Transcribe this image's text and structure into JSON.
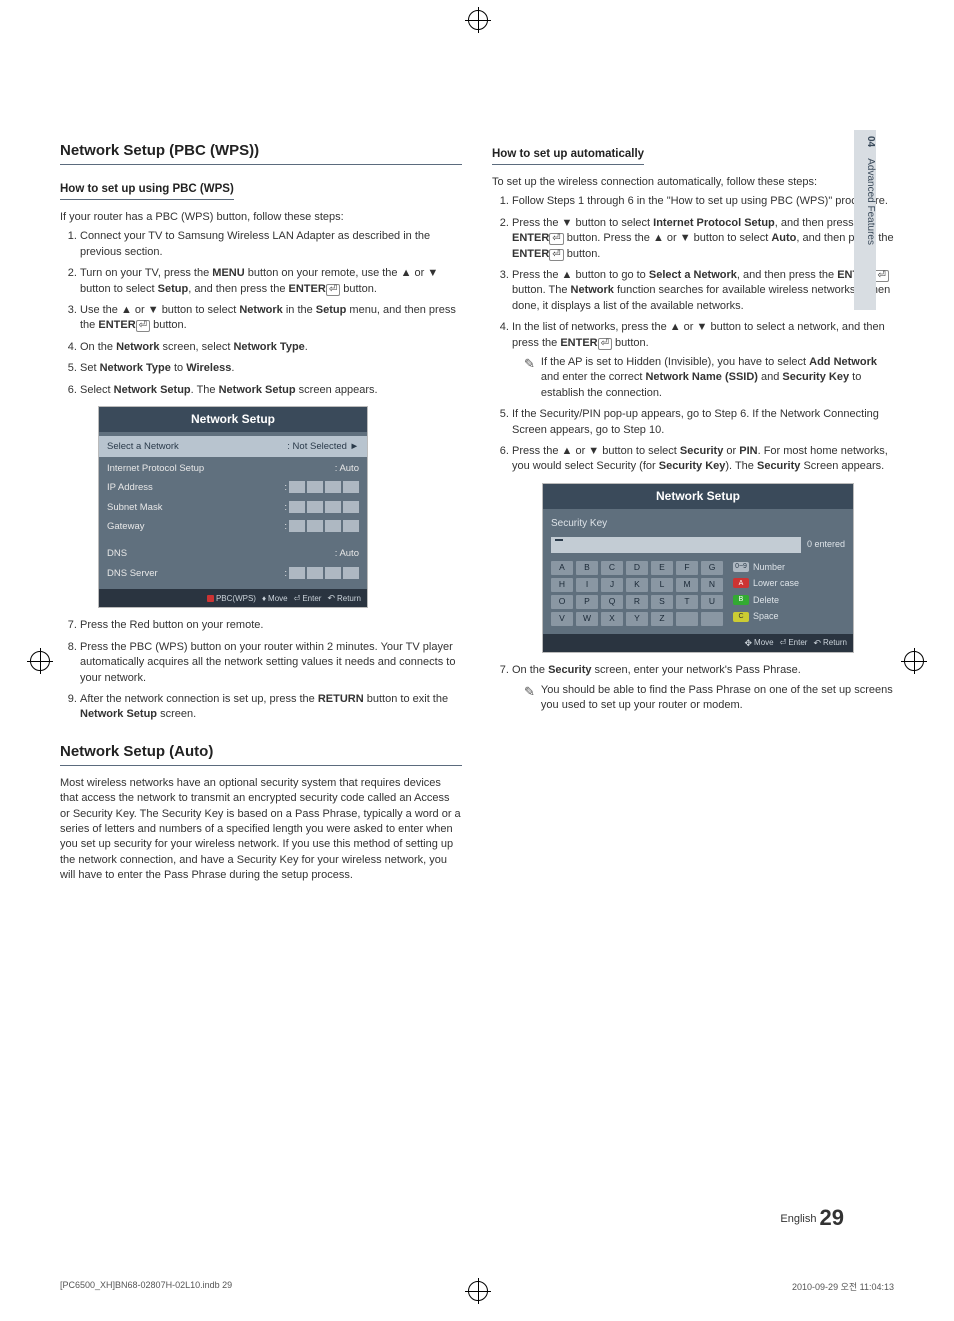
{
  "sideTab": {
    "num": "04",
    "label": "Advanced Features"
  },
  "left": {
    "title1": "Network Setup (PBC (WPS))",
    "sub1": "How to set up using PBC (WPS)",
    "intro1": "If your router has a PBC (WPS) button, follow these steps:",
    "s1": "Connect your TV to Samsung Wireless LAN Adapter as described in the previous section.",
    "s2a": "Turn on your TV, press the ",
    "s2_menu": "MENU",
    "s2b": " button on your remote, use the ▲ or ▼ button to select ",
    "s2_setup": "Setup",
    "s2c": ", and then press the ",
    "s2_enter": "ENTER",
    "s2d": " button.",
    "s3a": "Use the ▲ or ▼ button to select ",
    "s3_network": "Network",
    "s3b": " in the ",
    "s3_setup": "Setup",
    "s3c": " menu, and then press the ",
    "s3d": " button.",
    "s4a": "On the ",
    "s4_network": "Network",
    "s4b": " screen, select ",
    "s4_type": "Network Type",
    "s4c": ".",
    "s5a": "Set ",
    "s5_type": "Network Type",
    "s5b": " to ",
    "s5_wireless": "Wireless",
    "s5c": ".",
    "s6a": "Select ",
    "s6_ns": "Network Setup",
    "s6b": ". The ",
    "s6_ns2": "Network Setup",
    "s6c": " screen appears.",
    "tv": {
      "title": "Network Setup",
      "row1l": "Select a Network",
      "row1r": ": Not Selected   ►",
      "row2l": "Internet Protocol Setup",
      "row2r": ": Auto",
      "row3l": "IP Address",
      "row4l": "Subnet Mask",
      "row5l": "Gateway",
      "row6l": "DNS",
      "row6r": ": Auto",
      "row7l": "DNS Server",
      "f1": "PBC(WPS)",
      "f2": "Move",
      "f3": "Enter",
      "f4": "Return"
    },
    "s7": "Press the Red button on your remote.",
    "s8": "Press the PBC (WPS) button on your router within 2 minutes. Your TV player automatically acquires all the network setting values it needs and connects to your network.",
    "s9a": "After the network connection is set up, press the ",
    "s9_return": "RETURN",
    "s9b": " button to exit the ",
    "s9_ns": "Network Setup",
    "s9c": " screen.",
    "title2": "Network Setup (Auto)",
    "autoPara": "Most wireless networks have an optional security system that requires devices that access the network to transmit an encrypted security code called an Access or Security Key. The Security Key is based on a Pass Phrase, typically a word or a series of letters and numbers of a specified length you were asked to enter when you set up security for your wireless network.  If you use this method of setting up the network connection, and have a Security Key for your wireless network, you will have to enter the Pass Phrase during the setup process."
  },
  "right": {
    "sub1": "How to set up automatically",
    "intro1": "To set up the wireless connection automatically, follow these steps:",
    "s1": "Follow Steps 1 through 6 in the \"How to set up using PBC (WPS)\" procedure.",
    "s2a": "Press the ▼ button to select ",
    "s2_ips": "Internet Protocol Setup",
    "s2b": ", and then press the ",
    "s2_enter": "ENTER",
    "s2c": " button. Press the ▲ or ▼ button to select ",
    "s2_auto": "Auto",
    "s2d": ", and then press the ",
    "s2e": " button.",
    "s3a": "Press the ▲ button to go to ",
    "s3_sel": "Select a Network",
    "s3b": ", and then press the ",
    "s3c": " button. The ",
    "s3_net": "Network",
    "s3d": " function searches for available wireless networks. When done, it displays a list of the available networks.",
    "s4a": "In the list of networks, press the ▲ or ▼ button to select a network, and then press the ",
    "s4b": " button.",
    "note1a": "If the AP is set to Hidden (Invisible), you have to select ",
    "note1_add": "Add Network",
    "note1b": " and enter the correct ",
    "note1_ssid": "Network Name (SSID)",
    "note1c": " and ",
    "note1_key": "Security Key",
    "note1d": " to establish the connection.",
    "s5": "If the Security/PIN pop-up appears, go to Step 6. If the Network Connecting Screen appears, go to Step 10.",
    "s6a": "Press the ▲ or ▼ button to select ",
    "s6_sec": "Security",
    "s6b": " or ",
    "s6_pin": "PIN",
    "s6c": ". For most home networks, you would select Security (for ",
    "s6_skey": "Security Key",
    "s6d": "). The ",
    "s6_sec2": "Security",
    "s6e": " Screen appears.",
    "kb": {
      "title": "Network Setup",
      "label": "Security Key",
      "entered": "0 entered",
      "sideNum": "Number",
      "sideLower": "Lower case",
      "sideDelete": "Delete",
      "sideSpace": "Space",
      "numChip": "0~9",
      "f2": "Move",
      "f3": "Enter",
      "f4": "Return",
      "keys": [
        "A",
        "B",
        "C",
        "D",
        "E",
        "F",
        "G",
        "H",
        "I",
        "J",
        "K",
        "L",
        "M",
        "N",
        "O",
        "P",
        "Q",
        "R",
        "S",
        "T",
        "U",
        "V",
        "W",
        "X",
        "Y",
        "Z",
        "",
        ""
      ]
    },
    "s7a": "On the ",
    "s7_sec": "Security",
    "s7b": " screen, enter your network's Pass Phrase.",
    "note2": "You should be able to find the Pass Phrase on one of the set up screens you used to set up your router or modem."
  },
  "footer": {
    "lang": "English",
    "page": "29"
  },
  "meta": {
    "left": "[PC6500_XH]BN68-02807H-02L10.indb   29",
    "right": "2010-09-29   오전 11:04:13"
  }
}
